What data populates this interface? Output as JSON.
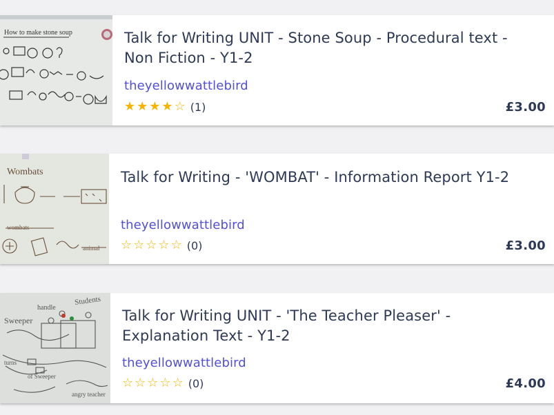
{
  "resources": [
    {
      "title": "Talk for Writing UNIT - Stone Soup - Procedural text - Non Fiction - Y1-2",
      "author": "theyellowwattlebird",
      "rating": 4,
      "review_count": "(1)",
      "price": "£3.00",
      "thumb_caption": "How to make stone soup"
    },
    {
      "title": "Talk for Writing - 'WOMBAT' - Information Report Y1-2",
      "author": "theyellowwattlebird",
      "rating": 0,
      "review_count": "(0)",
      "price": "£3.00",
      "thumb_caption": "Wombats"
    },
    {
      "title": "Talk for Writing UNIT - 'The Teacher Pleaser' - Explanation Text - Y1-2",
      "author": "theyellowwattlebird",
      "rating": 0,
      "review_count": "(0)",
      "price": "£4.00",
      "thumb_caption": "Students"
    }
  ],
  "colors": {
    "title": "#2e3a55",
    "author": "#5150d6",
    "star": "#f6b400",
    "background": "#f1f1f3"
  },
  "icons": {
    "star_filled": "star-filled-icon",
    "star_empty": "star-empty-icon"
  }
}
